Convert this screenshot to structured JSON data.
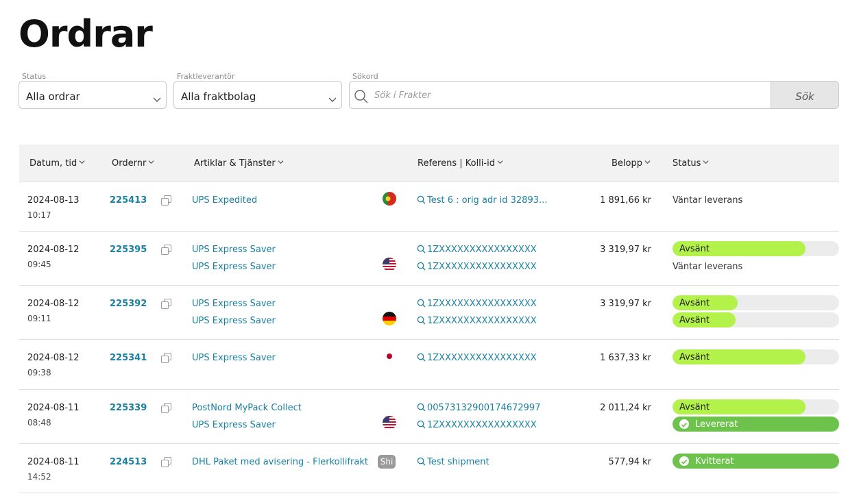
{
  "page": {
    "title": "Ordrar"
  },
  "filters": {
    "status": {
      "label": "Status",
      "value": "Alla ordrar"
    },
    "carrier": {
      "label": "Fraktleverantör",
      "value": "Alla fraktbolag"
    },
    "search": {
      "label": "Sökord",
      "placeholder": "Sök i Frakter",
      "button": "Sök"
    }
  },
  "table": {
    "headers": {
      "date": "Datum, tid",
      "order": "Ordernr",
      "items": "Artiklar & Tjänster",
      "ref": "Referens | Kolli-id",
      "amount": "Belopp",
      "status": "Status"
    },
    "rows": [
      {
        "date": "2024-08-13",
        "time": "10:17",
        "order": "225413",
        "country_flag": "portugal",
        "lines": [
          {
            "service": "UPS Expedited",
            "ref": "Test 6 : orig adr id 32893...",
            "status": "Väntar leverans",
            "status_type": "text"
          }
        ],
        "amount": "1 891,66 kr"
      },
      {
        "date": "2024-08-12",
        "time": "09:45",
        "order": "225395",
        "country_flag": "usa",
        "lines": [
          {
            "service": "UPS Express Saver",
            "ref": "1ZXXXXXXXXXXXXXXXX",
            "status": "Avsänt",
            "status_type": "bar",
            "progress": 0.8
          },
          {
            "service": "UPS Express Saver",
            "ref": "1ZXXXXXXXXXXXXXXXX",
            "status": "Väntar leverans",
            "status_type": "text"
          }
        ],
        "amount": "3 319,97 kr"
      },
      {
        "date": "2024-08-12",
        "time": "09:11",
        "order": "225392",
        "country_flag": "germany",
        "lines": [
          {
            "service": "UPS Express Saver",
            "ref": "1ZXXXXXXXXXXXXXXXX",
            "status": "Avsänt",
            "status_type": "bar",
            "progress": 0.39
          },
          {
            "service": "UPS Express Saver",
            "ref": "1ZXXXXXXXXXXXXXXXX",
            "status": "Avsänt",
            "status_type": "bar",
            "progress": 0.38
          }
        ],
        "amount": "3 319,97 kr"
      },
      {
        "date": "2024-08-12",
        "time": "09:38",
        "order": "225341",
        "country_flag": "japan",
        "lines": [
          {
            "service": "UPS Express Saver",
            "ref": "1ZXXXXXXXXXXXXXXXX",
            "status": "Avsänt",
            "status_type": "bar",
            "progress": 0.8
          }
        ],
        "amount": "1 637,33 kr"
      },
      {
        "date": "2024-08-11",
        "time": "08:48",
        "order": "225339",
        "country_flag": "usa",
        "lines": [
          {
            "service": "PostNord MyPack Collect",
            "ref": "00573132900174672997",
            "status": "Avsänt",
            "status_type": "bar",
            "progress": 0.8
          },
          {
            "service": "UPS Express Saver",
            "ref": "1ZXXXXXXXXXXXXXXXX",
            "status": "Levererat",
            "status_type": "done"
          }
        ],
        "amount": "2 011,24 kr"
      },
      {
        "date": "2024-08-11",
        "time": "14:52",
        "order": "224513",
        "badge": "Shi",
        "lines": [
          {
            "service": "DHL Paket med avisering - Flerkollifrakt",
            "ref": "Test shipment",
            "status": "Kvitterat",
            "status_type": "done"
          }
        ],
        "amount": "577,94 kr"
      }
    ]
  },
  "colors": {
    "link": "#1a7fa0",
    "progress": "#b3f24a",
    "done": "#6cc24a"
  }
}
